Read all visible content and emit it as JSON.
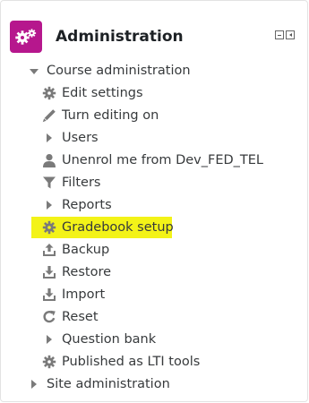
{
  "block": {
    "title": "Administration",
    "accent_color": "#b6178d",
    "highlight_color": "#f3f318"
  },
  "tree": {
    "course_admin": "Course administration",
    "items": {
      "edit_settings": "Edit settings",
      "turn_editing_on": "Turn editing on",
      "users": "Users",
      "unenrol": "Unenrol me from Dev_FED_TEL",
      "filters": "Filters",
      "reports": "Reports",
      "gradebook_setup": "Gradebook setup",
      "backup": "Backup",
      "restore": "Restore",
      "import": "Import",
      "reset": "Reset",
      "question_bank": "Question bank",
      "published_lti": "Published as LTI tools"
    },
    "site_admin": "Site administration"
  },
  "icons": [
    "gears-icon",
    "minimize-icon",
    "dock-left-icon",
    "expanded-caret-icon",
    "gear-icon",
    "pencil-icon",
    "collapsed-caret-icon",
    "user-icon",
    "filter-icon",
    "upload-icon",
    "download-icon",
    "reset-icon"
  ]
}
